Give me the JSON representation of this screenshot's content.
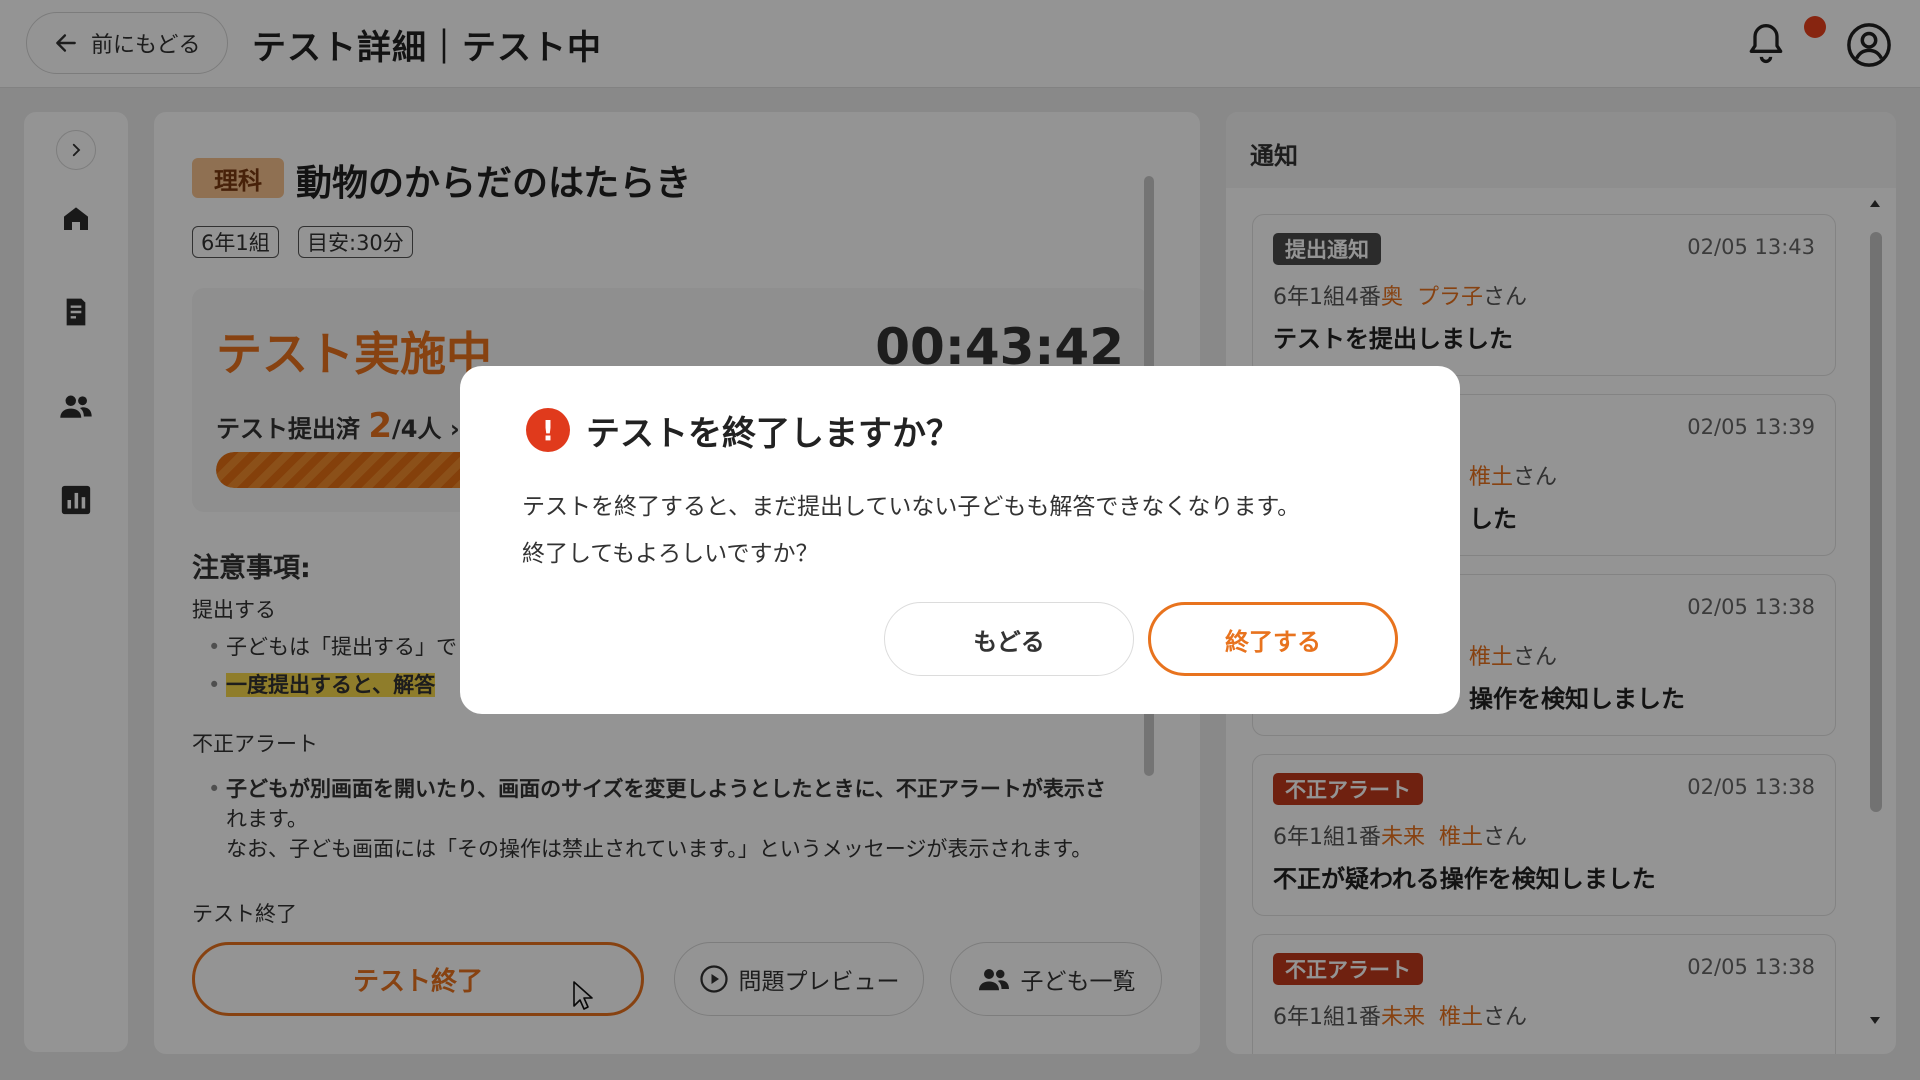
{
  "header": {
    "back_label": "前にもどる",
    "title": "テスト詳細｜テスト中",
    "bell_icon": "bell-icon",
    "avatar_icon": "user-circle-icon",
    "notification_dot_color": "#e8401c"
  },
  "sidebar": {
    "items": [
      {
        "icon": "chevron-right-icon"
      },
      {
        "icon": "home-icon"
      },
      {
        "icon": "edit-document-icon"
      },
      {
        "icon": "users-icon"
      },
      {
        "icon": "bar-chart-icon"
      }
    ]
  },
  "test": {
    "subject": "理科",
    "name": "動物のからだのはたらき",
    "class_chip": "6年1組",
    "time_chip": "目安:30分",
    "status": "テスト実施中",
    "timer": "00:43:42",
    "submitted_label": "テスト提出済",
    "submitted_count": "2",
    "submitted_total": "/4人",
    "submitted_arrow": "›",
    "progress_fraction": 0.5
  },
  "notes": {
    "title": "注意事項:",
    "section1": "提出する",
    "s1_bullet1": "子どもは「提出する」で",
    "s1_bullet2": "一度提出すると、解答",
    "section2": "不正アラート",
    "s2_bullet1_line1": "子どもが別画面を開いたり、画面のサイズを変更しようとしたときに、不正アラートが表示さ",
    "s2_bullet1_line2": "れます。",
    "s2_bullet1_line3": "なお、子ども画面には「その操作は禁止されています。」というメッセージが表示されます。",
    "section3": "テスト終了"
  },
  "actions": {
    "end_test": "テスト終了",
    "preview": "問題プレビュー",
    "students": "子ども一覧"
  },
  "notifications": {
    "title": "通知",
    "items": [
      {
        "badge": "提出通知",
        "badge_color": "#4a4a4a",
        "time": "02/05 13:43",
        "class_no": "6年1組4番",
        "last": "奥",
        "first": "プラ子",
        "suffix": "さん",
        "message": "テストを提出しました"
      },
      {
        "badge": "",
        "badge_color": "#4a4a4a",
        "time": "02/05 13:39",
        "class_no": "",
        "last": "",
        "first": "椎土",
        "suffix": "さん",
        "message": "した"
      },
      {
        "badge": "",
        "badge_color": "#c0391c",
        "time": "02/05 13:38",
        "class_no": "",
        "last": "",
        "first": "椎土",
        "suffix": "さん",
        "message": "操作を検知しました"
      },
      {
        "badge": "不正アラート",
        "badge_color": "#c0391c",
        "time": "02/05 13:38",
        "class_no": "6年1組1番",
        "last": "未来",
        "first": "椎土",
        "suffix": "さん",
        "message": "不正が疑われる操作を検知しました"
      },
      {
        "badge": "不正アラート",
        "badge_color": "#c0391c",
        "time": "02/05 13:38",
        "class_no": "6年1組1番",
        "last": "未来",
        "first": "椎土",
        "suffix": "さん",
        "message": ""
      }
    ]
  },
  "modal": {
    "icon": "exclamation-circle-icon",
    "title": "テストを終了しますか？",
    "body_line1": "テストを終了すると、まだ提出していない子どもも解答できなくなります。",
    "body_line2": "終了してもよろしいですか？",
    "cancel_label": "もどる",
    "confirm_label": "終了する"
  },
  "colors": {
    "accent": "#e8731e",
    "alert": "#c0391c",
    "subject_tag": "#f6c28e"
  }
}
